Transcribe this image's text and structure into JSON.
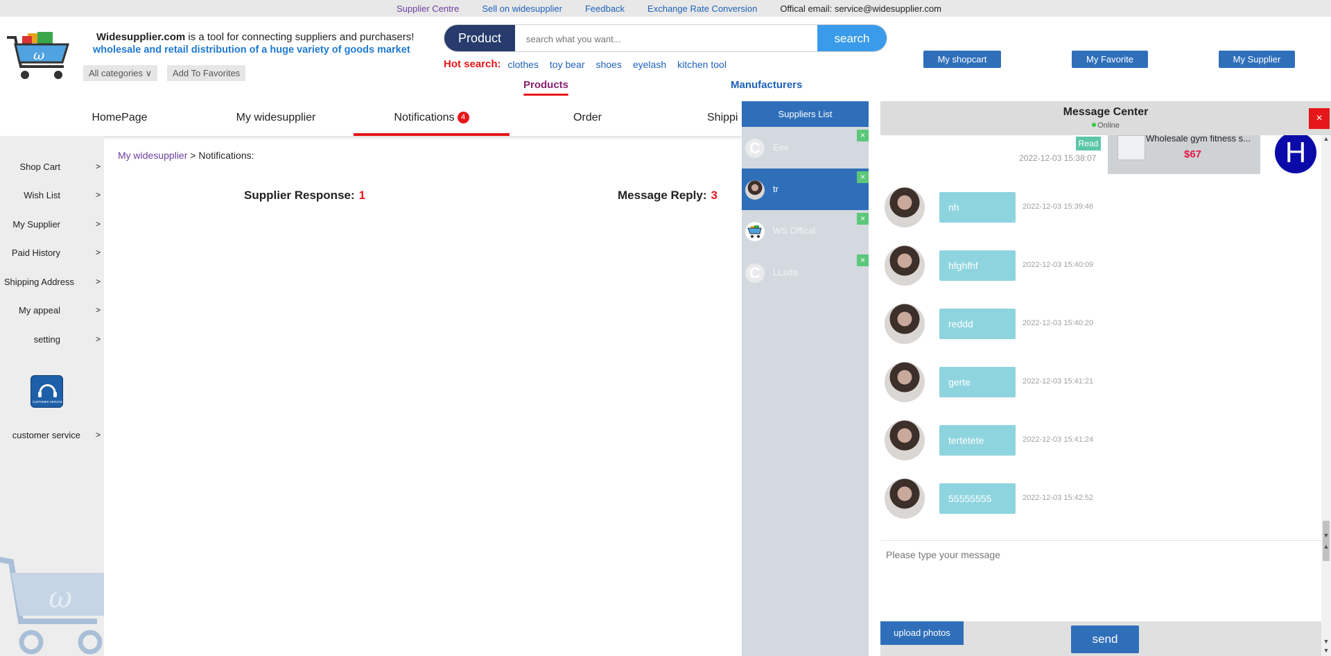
{
  "topbar": {
    "links": [
      "Supplier Centre",
      "Sell on widesupplier",
      "Feedback",
      "Exchange Rate Conversion"
    ],
    "email": "Offical email: service@widesupplier.com"
  },
  "header": {
    "brand": "Widesupplier.com",
    "tagline_rest": " is a tool for connecting suppliers and purchasers!",
    "tagline2": "wholesale and retail distribution of a huge variety of goods market",
    "all_categories": "All categories ∨",
    "add_favorites": "Add To Favorites",
    "search": {
      "category": "Product",
      "placeholder": "search what you want...",
      "button": "search"
    },
    "hot_search": {
      "label": "Hot search:",
      "terms": [
        "clothes",
        "toy bear",
        "shoes",
        "eyelash",
        "kitchen tool"
      ]
    },
    "tabs": {
      "products": "Products",
      "manufacturers": "Manufacturers"
    },
    "buttons": {
      "shopcart": "My shopcart",
      "favorite": "My Favorite",
      "supplier": "My Supplier"
    }
  },
  "nav": {
    "items": [
      "HomePage",
      "My widesupplier",
      "Notifications",
      "Order",
      "Shippi"
    ],
    "notifications_badge": "4",
    "active": "Notifications"
  },
  "sidebar": {
    "items": [
      "Shop Cart",
      "Wish List",
      "My Supplier",
      "Paid History",
      "Shipping Address",
      "My appeal",
      "setting"
    ],
    "arrow": ">",
    "customer_service": "customer service",
    "cs_icon_text": "CUSTOMER SERVICE"
  },
  "content": {
    "breadcrumb_link": "My widesupplier",
    "breadcrumb_sep": " > ",
    "breadcrumb_current": "Notifications:",
    "supplier_response_label": "Supplier Response:",
    "supplier_response_count": "1",
    "message_reply_label": "Message Reply:",
    "message_reply_count": "3"
  },
  "suppliers_list": {
    "title": "Suppliers List",
    "contacts": [
      {
        "name": "Eee",
        "avatar": "C",
        "selected": false
      },
      {
        "name": "tr",
        "avatar": "photo",
        "selected": true
      },
      {
        "name": "WS Offical",
        "avatar": "cart-logo",
        "selected": false
      },
      {
        "name": "LLsda",
        "avatar": "C",
        "selected": false
      }
    ],
    "remove_symbol": "×"
  },
  "message_center": {
    "title": "Message Center",
    "status": "Online",
    "close": "×",
    "product_card": {
      "read_label": "Read",
      "timestamp": "2022-12-03 15:38:07",
      "title": "Wholesale gym fitness s...",
      "price": "$67",
      "self_avatar": "H"
    },
    "messages": [
      {
        "text": "nh",
        "time": "2022-12-03 15:39:46"
      },
      {
        "text": "hfghfhf",
        "time": "2022-12-03 15:40:09"
      },
      {
        "text": "reddd",
        "time": "2022-12-03 15:40:20"
      },
      {
        "text": "gerte",
        "time": "2022-12-03 15:41:21"
      },
      {
        "text": "tertetete",
        "time": "2022-12-03 15:41:24"
      },
      {
        "text": "55555555",
        "time": "2022-12-03 15:42:52"
      }
    ],
    "input_placeholder": "Please type your message",
    "upload": "upload photos",
    "send": "send"
  },
  "colors": {
    "brand_blue": "#2f6fba",
    "accent_red": "#e5171a",
    "bubble": "#8ed4df",
    "navy": "#273c6c"
  }
}
